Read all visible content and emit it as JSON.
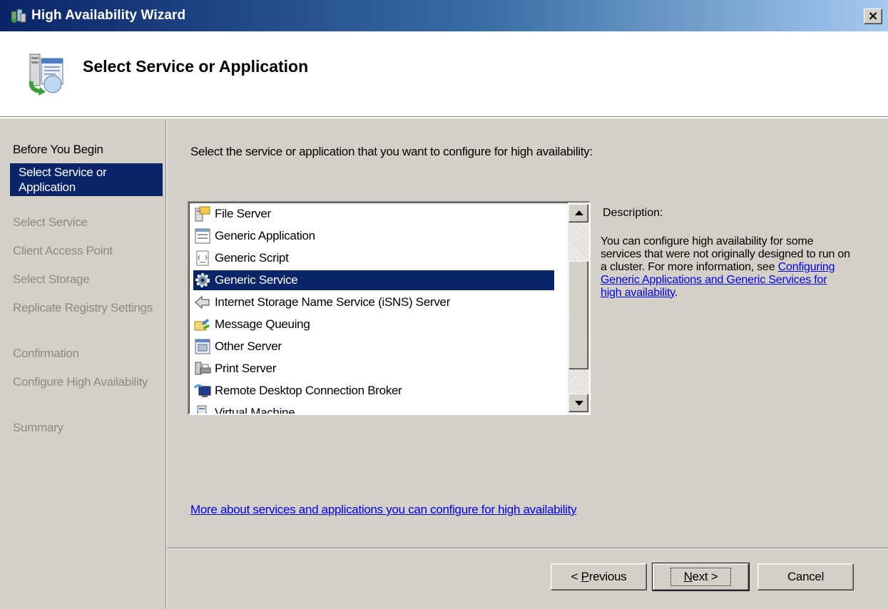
{
  "window": {
    "title": "High Availability Wizard",
    "close_glyph": "×"
  },
  "header": {
    "title": "Select Service or Application",
    "icon": "wizard-server-icon"
  },
  "nav": {
    "items": [
      {
        "label": "Before You Begin",
        "state": "done"
      },
      {
        "label": "Select Service or Application",
        "state": "current"
      },
      {
        "label": "Select Service",
        "state": "disabled"
      },
      {
        "label": "Client Access Point",
        "state": "disabled"
      },
      {
        "label": "Select Storage",
        "state": "disabled"
      },
      {
        "label": "Replicate Registry Settings",
        "state": "disabled"
      },
      {
        "label": "Confirmation",
        "state": "disabled"
      },
      {
        "label": "Configure High Availability",
        "state": "disabled"
      },
      {
        "label": "Summary",
        "state": "disabled"
      }
    ]
  },
  "main": {
    "instruction": "Select the service or application that you want to configure for high availability:",
    "list": {
      "items": [
        {
          "label": "File Server",
          "icon": "file-server-icon"
        },
        {
          "label": "Generic Application",
          "icon": "generic-application-icon"
        },
        {
          "label": "Generic Script",
          "icon": "generic-script-icon"
        },
        {
          "label": "Generic Service",
          "icon": "gear-icon",
          "selected": true
        },
        {
          "label": "Internet Storage Name Service (iSNS) Server",
          "icon": "isns-icon"
        },
        {
          "label": "Message Queuing",
          "icon": "message-queuing-icon"
        },
        {
          "label": "Other Server",
          "icon": "other-server-icon"
        },
        {
          "label": "Print Server",
          "icon": "printer-icon"
        },
        {
          "label": "Remote Desktop Connection Broker",
          "icon": "remote-desktop-icon"
        },
        {
          "label": "Virtual Machine",
          "icon": "virtual-machine-icon"
        }
      ],
      "selected": "Generic Service"
    },
    "description": {
      "label": "Description:",
      "text_before": "You can configure high availability for some services that were not originally designed to run on a cluster. For more information, see ",
      "link": "Configuring Generic Applications and Generic Services for high availability",
      "text_after": "."
    },
    "more_link": "More about services and applications you can configure for high availability"
  },
  "buttons": {
    "previous": {
      "prefix": "< ",
      "mnemonic": "P",
      "rest": "revious"
    },
    "next": {
      "mnemonic": "N",
      "rest": "ext >"
    },
    "cancel": "Cancel"
  },
  "colors": {
    "title_bar": "#0a246a",
    "selection": "#0a246a",
    "link": "#0000ee",
    "face": "#d4d0c8"
  }
}
